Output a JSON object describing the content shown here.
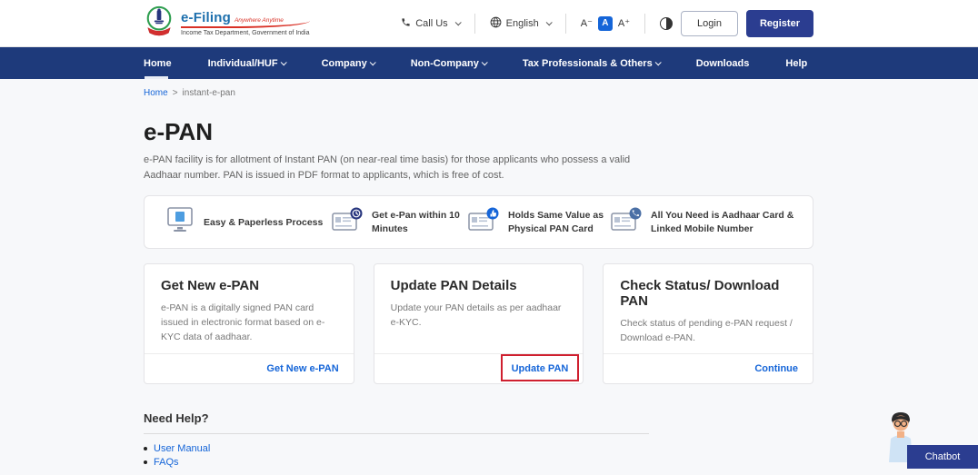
{
  "header": {
    "logo": {
      "emblem_icon": "income-tax-emblem-icon",
      "brand": "e-Filing",
      "tagline": "Anywhere Anytime",
      "subtitle": "Income Tax Department, Government of India"
    },
    "call_us_label": "Call Us",
    "language_label": "English",
    "font_controls": {
      "decrease": "A⁻",
      "normal": "A",
      "increase": "A⁺"
    },
    "login_label": "Login",
    "register_label": "Register",
    "icons": [
      "phone-icon",
      "globe-icon",
      "contrast-toggle-icon"
    ]
  },
  "nav": {
    "items": [
      {
        "label": "Home",
        "active": true,
        "has_dropdown": false
      },
      {
        "label": "Individual/HUF",
        "active": false,
        "has_dropdown": true
      },
      {
        "label": "Company",
        "active": false,
        "has_dropdown": true
      },
      {
        "label": "Non-Company",
        "active": false,
        "has_dropdown": true
      },
      {
        "label": "Tax Professionals & Others",
        "active": false,
        "has_dropdown": true
      },
      {
        "label": "Downloads",
        "active": false,
        "has_dropdown": false
      },
      {
        "label": "Help",
        "active": false,
        "has_dropdown": false
      }
    ]
  },
  "breadcrumb": {
    "home": "Home",
    "separator": ">",
    "current": "instant-e-pan"
  },
  "page": {
    "title": "e-PAN",
    "description": "e-PAN facility is for allotment of Instant PAN (on near-real time basis) for those applicants who possess a valid Aadhaar number. PAN is issued in PDF format to applicants, which is free of cost."
  },
  "features": [
    {
      "icon": "monitor-document-icon",
      "label": "Easy & Paperless Process"
    },
    {
      "icon": "pan-card-clock-icon",
      "label": "Get e-Pan within 10 Minutes"
    },
    {
      "icon": "pan-card-thumbsup-icon",
      "label": "Holds Same Value as Physical PAN Card"
    },
    {
      "icon": "pan-card-phone-icon",
      "label": "All You Need is Aadhaar Card & Linked Mobile Number"
    }
  ],
  "cards": [
    {
      "title": "Get New e-PAN",
      "description": "e-PAN is a digitally signed PAN card issued in electronic format based on e-KYC data of aadhaar.",
      "action": "Get New e-PAN",
      "highlighted": false
    },
    {
      "title": "Update PAN Details",
      "description": "Update your PAN details as per aadhaar e-KYC.",
      "action": "Update PAN",
      "highlighted": true
    },
    {
      "title": "Check Status/ Download PAN",
      "description": "Check status of pending e-PAN request / Download e-PAN.",
      "action": "Continue",
      "highlighted": false
    }
  ],
  "need_help": {
    "title": "Need Help?",
    "links": [
      "User Manual",
      "FAQs"
    ]
  },
  "chatbot": {
    "label": "Chatbot",
    "avatar_icon": "chatbot-assistant-avatar"
  },
  "colors": {
    "nav_blue": "#1e3a7b",
    "register_blue": "#2b3d90",
    "link_blue": "#1565d8",
    "highlight_red": "#cf1f2f",
    "brand_blue": "#1c6fad",
    "brand_red": "#d93025"
  }
}
